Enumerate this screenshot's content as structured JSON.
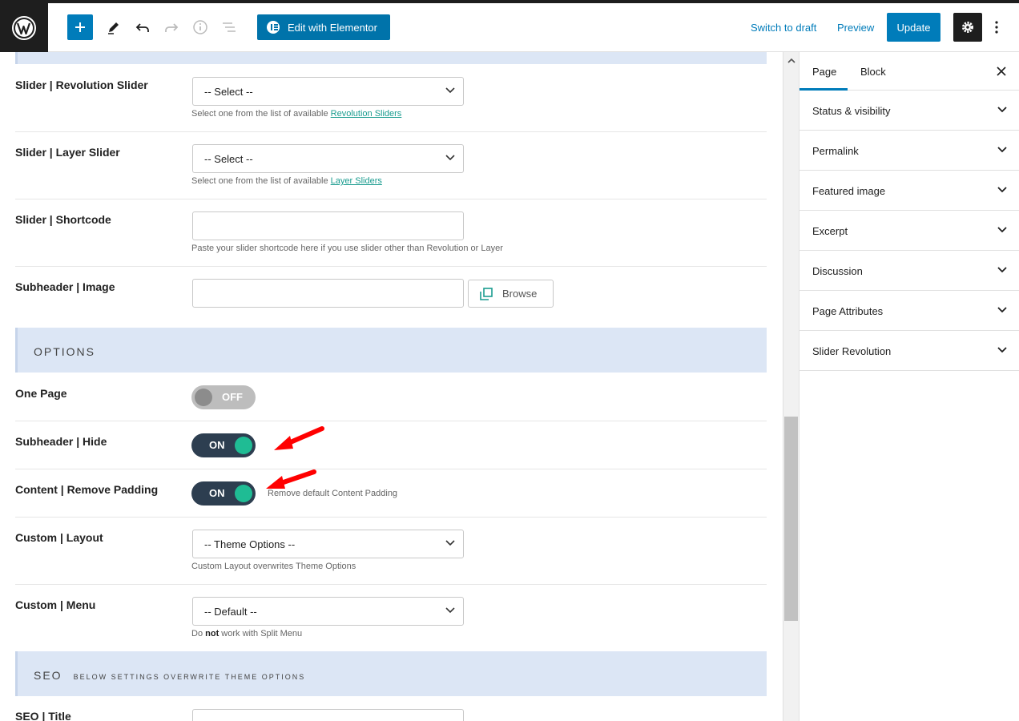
{
  "toolbar": {
    "edit_with_elementor": "Edit with Elementor",
    "switch_to_draft": "Switch to draft",
    "preview": "Preview",
    "update": "Update"
  },
  "fields": {
    "revolution_slider": {
      "label": "Slider | Revolution Slider",
      "value": "-- Select --",
      "help_prefix": "Select one from the list of available ",
      "help_link": "Revolution Sliders"
    },
    "layer_slider": {
      "label": "Slider | Layer Slider",
      "value": "-- Select --",
      "help_prefix": "Select one from the list of available ",
      "help_link": "Layer Sliders"
    },
    "shortcode": {
      "label": "Slider | Shortcode",
      "value": "",
      "help": "Paste your slider shortcode here if you use slider other than Revolution or Layer"
    },
    "subheader_image": {
      "label": "Subheader | Image",
      "value": "",
      "browse": "Browse"
    }
  },
  "options_section": {
    "title": "OPTIONS",
    "one_page": {
      "label": "One Page",
      "state": "OFF"
    },
    "subheader_hide": {
      "label": "Subheader | Hide",
      "state": "ON"
    },
    "content_remove_padding": {
      "label": "Content | Remove Padding",
      "state": "ON",
      "help": "Remove default Content Padding"
    },
    "custom_layout": {
      "label": "Custom | Layout",
      "value": "-- Theme Options --",
      "help": "Custom Layout overwrites Theme Options"
    },
    "custom_menu": {
      "label": "Custom | Menu",
      "value": "-- Default --",
      "help_pre": "Do ",
      "help_bold": "not",
      "help_post": " work with Split Menu"
    }
  },
  "seo_section": {
    "title": "SEO",
    "subtitle": "BELOW SETTINGS OVERWRITE THEME OPTIONS",
    "seo_title": {
      "label": "SEO | Title",
      "value": ""
    }
  },
  "sidebar": {
    "tabs": [
      {
        "label": "Page"
      },
      {
        "label": "Block"
      }
    ],
    "panels": [
      {
        "label": "Status & visibility"
      },
      {
        "label": "Permalink"
      },
      {
        "label": "Featured image"
      },
      {
        "label": "Excerpt"
      },
      {
        "label": "Discussion"
      },
      {
        "label": "Page Attributes"
      },
      {
        "label": "Slider Revolution"
      }
    ]
  },
  "colors": {
    "accent": "#007cba",
    "toggle_on_track": "#2d3e50",
    "toggle_on_knob": "#1fbc94",
    "section_band": "#dce6f5",
    "arrow": "#ff0000"
  }
}
